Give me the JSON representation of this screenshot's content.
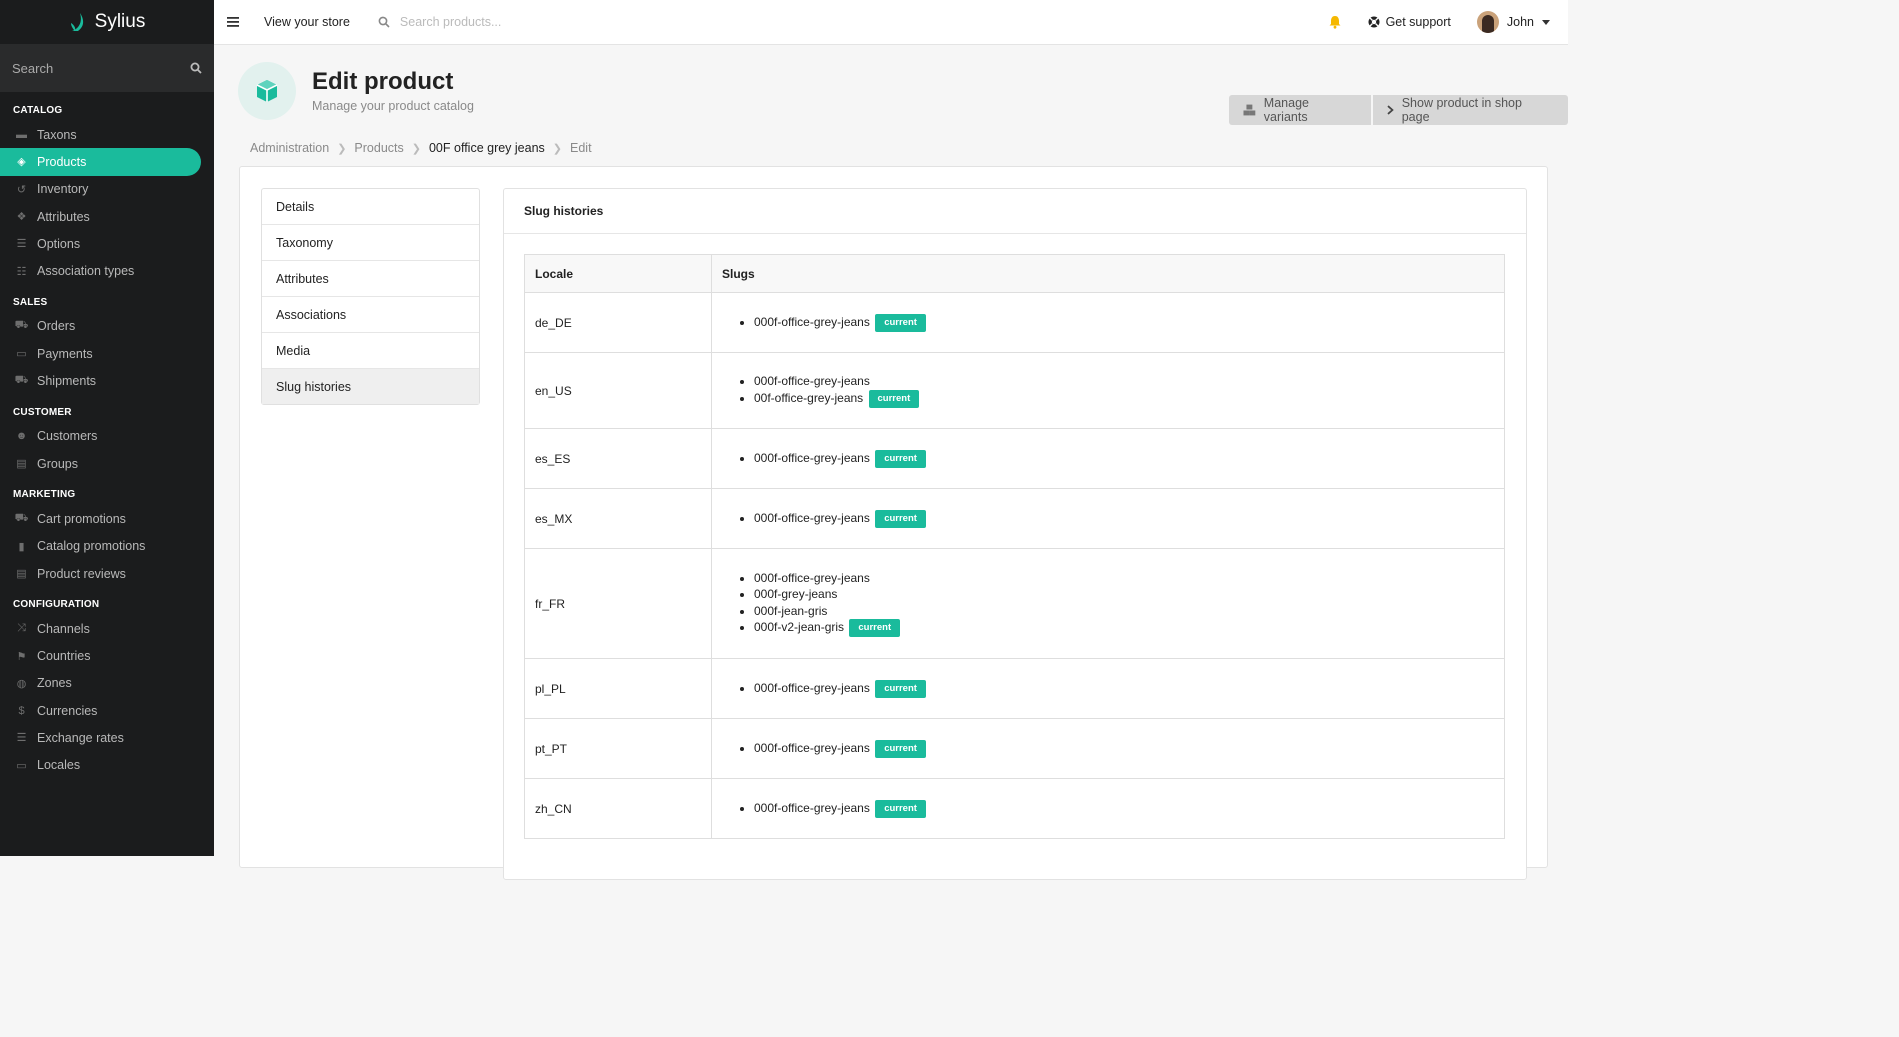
{
  "brand": {
    "name": "Sylius",
    "accent": "#1abb9c"
  },
  "sidebar": {
    "search_placeholder": "Search",
    "sections": [
      {
        "title": "CATALOG",
        "items": [
          {
            "label": "Taxons",
            "icon": "folder-icon"
          },
          {
            "label": "Products",
            "icon": "cube-icon",
            "active": true
          },
          {
            "label": "Inventory",
            "icon": "history-icon"
          },
          {
            "label": "Attributes",
            "icon": "cubes-icon"
          },
          {
            "label": "Options",
            "icon": "options-icon"
          },
          {
            "label": "Association types",
            "icon": "list-icon"
          }
        ]
      },
      {
        "title": "SALES",
        "items": [
          {
            "label": "Orders",
            "icon": "cart-icon"
          },
          {
            "label": "Payments",
            "icon": "payment-icon"
          },
          {
            "label": "Shipments",
            "icon": "truck-icon"
          }
        ]
      },
      {
        "title": "CUSTOMER",
        "items": [
          {
            "label": "Customers",
            "icon": "users-icon"
          },
          {
            "label": "Groups",
            "icon": "archive-icon"
          }
        ]
      },
      {
        "title": "MARKETING",
        "items": [
          {
            "label": "Cart promotions",
            "icon": "cart-icon"
          },
          {
            "label": "Catalog promotions",
            "icon": "bookmark-icon"
          },
          {
            "label": "Product reviews",
            "icon": "newspaper-icon"
          }
        ]
      },
      {
        "title": "CONFIGURATION",
        "items": [
          {
            "label": "Channels",
            "icon": "shuffle-icon"
          },
          {
            "label": "Countries",
            "icon": "flag-icon"
          },
          {
            "label": "Zones",
            "icon": "globe-icon"
          },
          {
            "label": "Currencies",
            "icon": "dollar-icon"
          },
          {
            "label": "Exchange rates",
            "icon": "exchange-icon"
          },
          {
            "label": "Locales",
            "icon": "language-icon"
          }
        ]
      }
    ]
  },
  "topbar": {
    "view_store": "View your store",
    "search_placeholder": "Search products...",
    "support": "Get support",
    "user": "John"
  },
  "header": {
    "title": "Edit product",
    "subtitle": "Manage your product catalog",
    "manage_variants": "Manage variants",
    "show_in_shop": "Show product in shop page"
  },
  "breadcrumb": [
    "Administration",
    "Products",
    "00F office grey jeans",
    "Edit"
  ],
  "tabs": [
    "Details",
    "Taxonomy",
    "Attributes",
    "Associations",
    "Media",
    "Slug histories"
  ],
  "active_tab": "Slug histories",
  "slug_histories": {
    "title": "Slug histories",
    "columns": [
      "Locale",
      "Slugs"
    ],
    "current_label": "current",
    "rows": [
      {
        "locale": "de_DE",
        "slugs": [
          "000f-office-grey-jeans"
        ]
      },
      {
        "locale": "en_US",
        "slugs": [
          "000f-office-grey-jeans",
          "00f-office-grey-jeans"
        ]
      },
      {
        "locale": "es_ES",
        "slugs": [
          "000f-office-grey-jeans"
        ]
      },
      {
        "locale": "es_MX",
        "slugs": [
          "000f-office-grey-jeans"
        ]
      },
      {
        "locale": "fr_FR",
        "slugs": [
          "000f-office-grey-jeans",
          "000f-grey-jeans",
          "000f-jean-gris",
          "000f-v2-jean-gris"
        ]
      },
      {
        "locale": "pl_PL",
        "slugs": [
          "000f-office-grey-jeans"
        ]
      },
      {
        "locale": "pt_PT",
        "slugs": [
          "000f-office-grey-jeans"
        ]
      },
      {
        "locale": "zh_CN",
        "slugs": [
          "000f-office-grey-jeans"
        ]
      }
    ]
  }
}
